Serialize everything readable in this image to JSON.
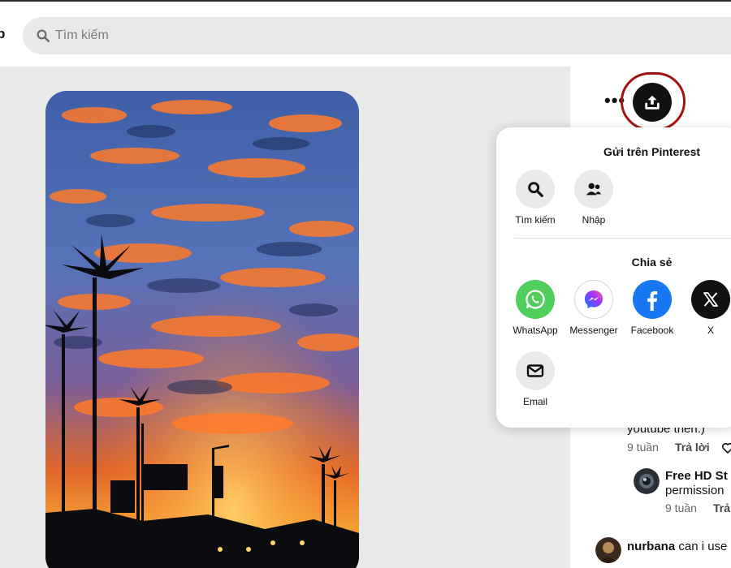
{
  "header": {
    "nav_fragment": "p",
    "search_placeholder": "Tìm kiếm"
  },
  "pin": {
    "actions": {
      "more_label": "•••"
    }
  },
  "share_menu": {
    "send_title": "Gửi trên Pinterest",
    "send_options": [
      {
        "label": "Tìm kiếm",
        "icon": "search-icon"
      },
      {
        "label": "Nhập",
        "icon": "people-icon"
      }
    ],
    "share_title": "Chia sẻ",
    "share_options": [
      {
        "label": "WhatsApp",
        "icon": "whatsapp-icon",
        "color": "#4fce5d"
      },
      {
        "label": "Messenger",
        "icon": "messenger-icon",
        "color": "#a033ff"
      },
      {
        "label": "Facebook",
        "icon": "facebook-icon",
        "color": "#1877f2"
      },
      {
        "label": "X",
        "icon": "x-icon",
        "color": "#111111"
      },
      {
        "label": "Email",
        "icon": "email-icon",
        "color": "#e9e9e9"
      }
    ]
  },
  "comments": [
    {
      "text": "youtube then:)",
      "age": "9 tuần",
      "reply": "Trả lời"
    },
    {
      "author": "Free HD St",
      "text": "permission",
      "age": "9 tuần",
      "reply": "Trả"
    },
    {
      "author": "nurbana",
      "text": "can i use"
    }
  ],
  "colors": {
    "highlight": "#a41212",
    "search_bg": "#e9e9e9",
    "share_button": "#111111"
  }
}
